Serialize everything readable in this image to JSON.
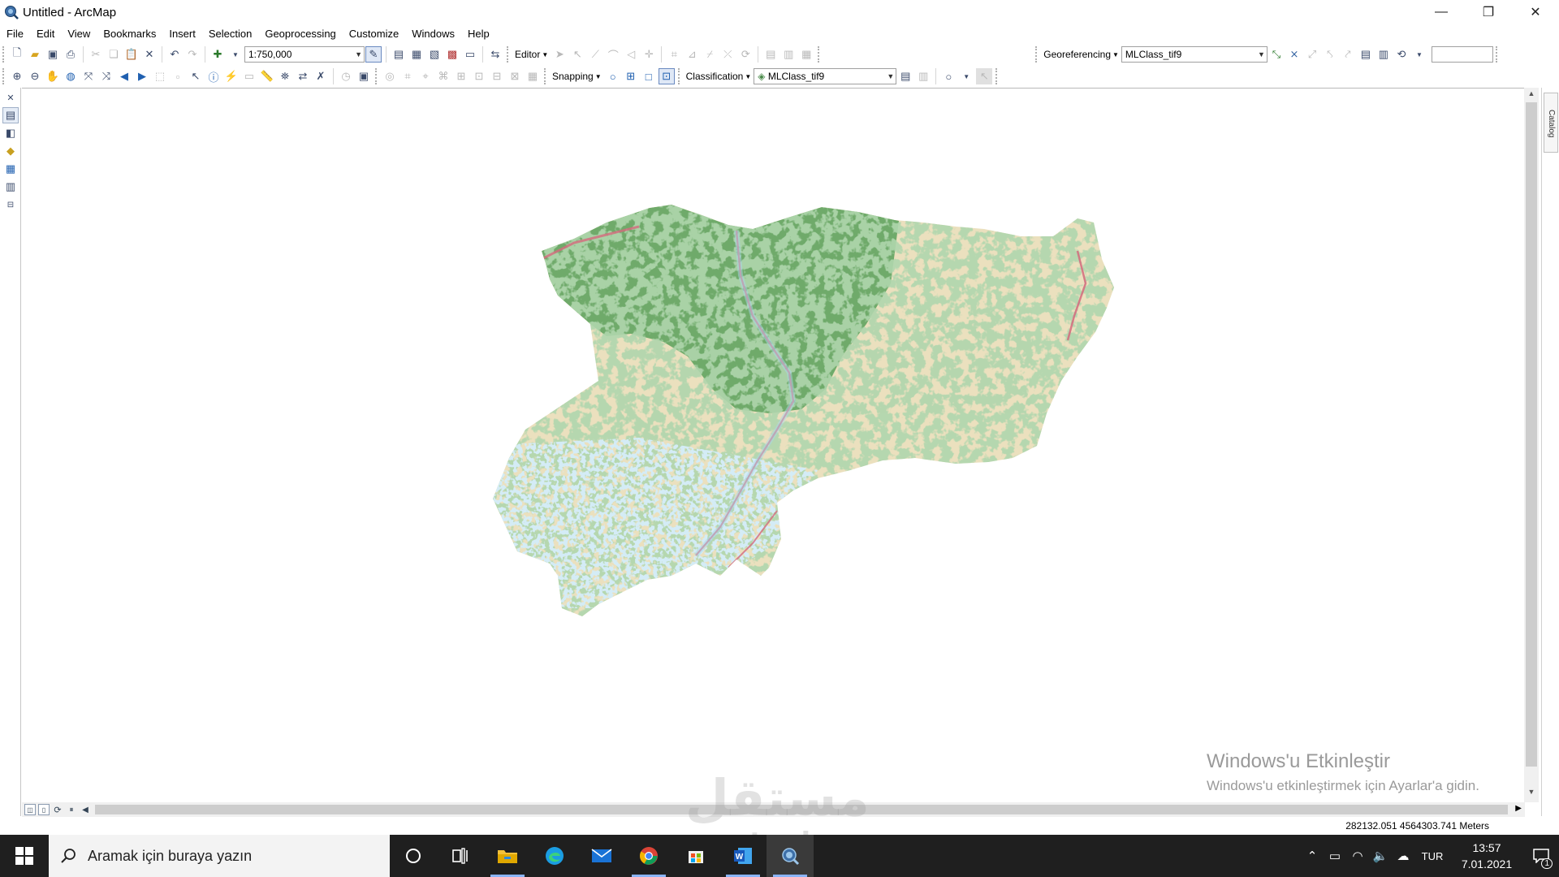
{
  "window": {
    "title": "Untitled - ArcMap"
  },
  "menu": [
    "File",
    "Edit",
    "View",
    "Bookmarks",
    "Insert",
    "Selection",
    "Geoprocessing",
    "Customize",
    "Windows",
    "Help"
  ],
  "toolbar1": {
    "scale": "1:750,000",
    "editor_label": "Editor",
    "georeferencing_label": "Georeferencing",
    "georef_layer": "MLClass_tif9",
    "right_input": ""
  },
  "toolbar2": {
    "snapping_label": "Snapping",
    "classification_label": "Classification",
    "classification_layer": "MLClass_tif9"
  },
  "sidepanel": {
    "catalog_label": "Catalog"
  },
  "status": {
    "coordinates": "282132.051  4564303.741 Meters"
  },
  "activation": {
    "title": "Windows'u Etkinleştir",
    "subtitle": "Windows'u etkinleştirmek için Ayarlar'a gidin."
  },
  "watermark": {
    "arabic": "مستقل",
    "latin": "mostaql.com"
  },
  "taskbar": {
    "search_placeholder": "Aramak için buraya yazın",
    "language": "TUR",
    "time": "13:57",
    "date": "7.01.2021",
    "notification_count": "1"
  },
  "map": {
    "classes": [
      {
        "name": "forest",
        "color": "#6faa6a"
      },
      {
        "name": "bare-agri",
        "color": "#ebe0be"
      },
      {
        "name": "water",
        "color": "#a9d5ea"
      },
      {
        "name": "urban",
        "color": "#d46a7d"
      }
    ]
  }
}
